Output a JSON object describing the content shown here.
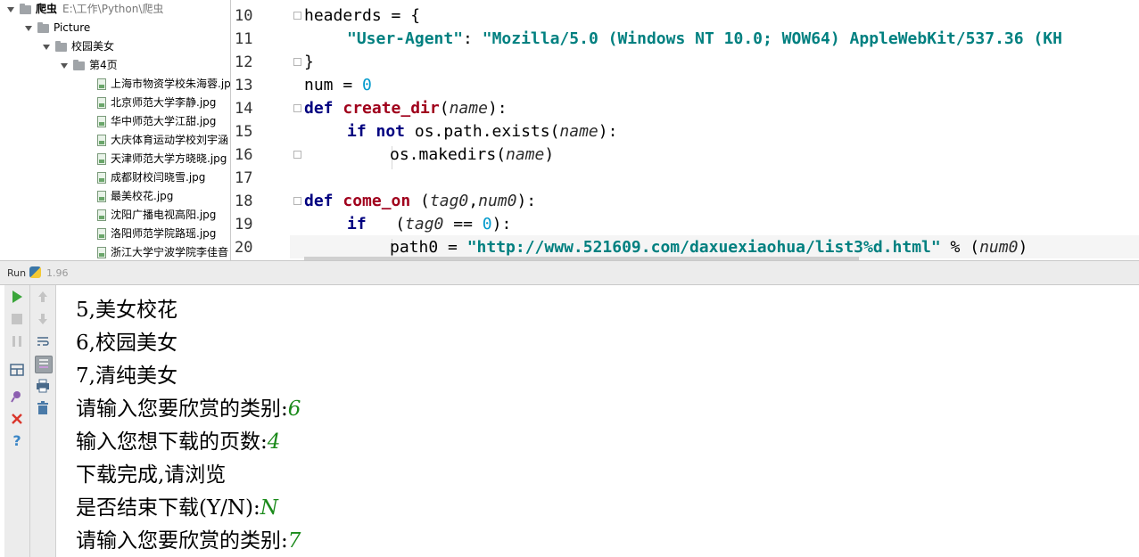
{
  "project": {
    "root_name": "爬虫",
    "root_path": "E:\\工作\\Python\\爬虫",
    "folders": [
      "Picture",
      "校园美女",
      "第4页"
    ],
    "files": [
      "上海市物资学校朱海蓉.jpg",
      "北京师范大学李静.jpg",
      "华中师范大学江甜.jpg",
      "大庆体育运动学校刘宇涵",
      "天津师范大学方晓晓.jpg",
      "成都财校闫晓雪.jpg",
      "最美校花.jpg",
      "沈阳广播电视高阳.jpg",
      "洛阳师范学院路瑶.jpg",
      "浙江大学宁波学院李佳音"
    ]
  },
  "editor": {
    "line_numbers": [
      "10",
      "11",
      "12",
      "13",
      "14",
      "15",
      "16",
      "17",
      "18",
      "19",
      "20"
    ],
    "code": {
      "l10_a": "headerds = {",
      "l11_key": "\"User-Agent\"",
      "l11_colon": ": ",
      "l11_val": "\"Mozilla/5.0 (Windows NT 10.0; WOW64) AppleWebKit/537.36 (KH",
      "l12": "}",
      "l13_a": "num = ",
      "l13_num": "0",
      "l14_def": "def ",
      "l14_fn": "create_dir",
      "l14_open": "(",
      "l14_par": "name",
      "l14_close": "):",
      "l15_if": "if not ",
      "l15_call": "os.path.exists(",
      "l15_par": "name",
      "l15_close": "):",
      "l16_call": "os.makedirs(",
      "l16_par": "name",
      "l16_close": ")",
      "l18_def": "def ",
      "l18_fn": "come_on",
      "l18_open": " (",
      "l18_par1": "tag0",
      "l18_comma": ",",
      "l18_par2": "num0",
      "l18_close": "):",
      "l19_if": "if",
      "l19_open": "   (",
      "l19_par": "tag0",
      "l19_eq": " == ",
      "l19_num": "0",
      "l19_close": "):",
      "l20_a": "path0 = ",
      "l20_str": "\"http://www.521609.com/daxuexiaohua/list3%d.html\"",
      "l20_op": " % (",
      "l20_par": "num0",
      "l20_close": ")"
    }
  },
  "run": {
    "label": "Run",
    "config": "1.96"
  },
  "console": {
    "lines": [
      {
        "text": "5,美女校花",
        "input": ""
      },
      {
        "text": "6,校园美女",
        "input": ""
      },
      {
        "text": "7,清纯美女",
        "input": ""
      },
      {
        "text": "请输入您要欣赏的类别:",
        "input": "6"
      },
      {
        "text": "输入您想下载的页数:",
        "input": "4"
      },
      {
        "text": "下载完成,请浏览",
        "input": ""
      },
      {
        "text": "是否结束下载(Y/N):",
        "input": "N"
      },
      {
        "text": "请输入您要欣赏的类别:",
        "input": "7"
      }
    ]
  },
  "colors": {
    "run_green": "#3aa53a",
    "stop_red": "#d9352a",
    "help_blue": "#3b86c6",
    "input_green": "#1a8a1a"
  }
}
